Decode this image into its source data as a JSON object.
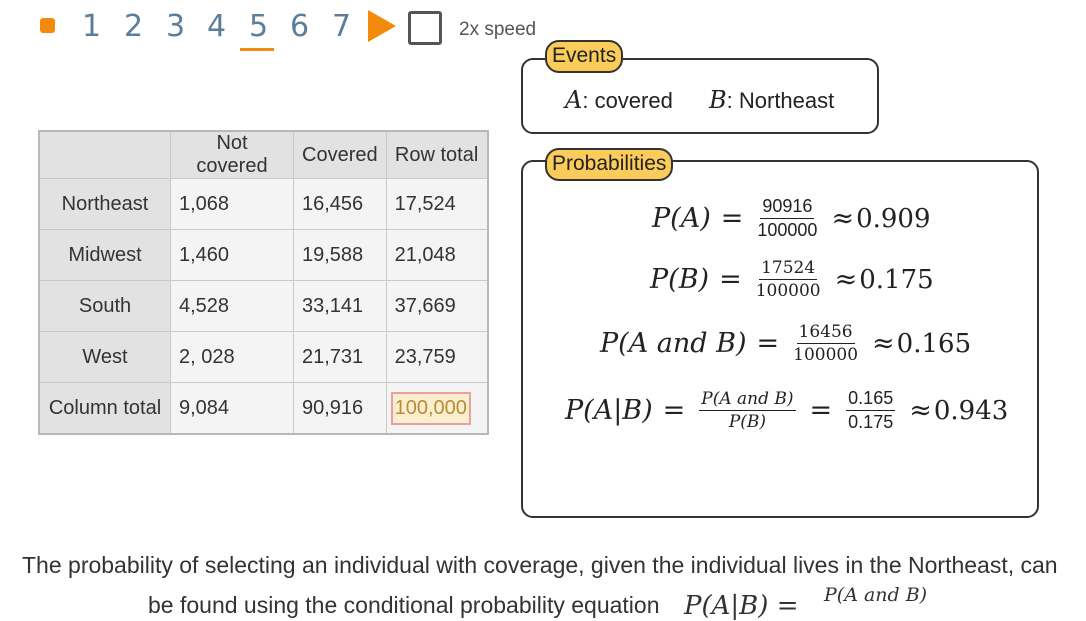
{
  "nav": {
    "steps": [
      "1",
      "2",
      "3",
      "4",
      "5",
      "6",
      "7"
    ],
    "active_step": "5",
    "speed_label": "2x speed"
  },
  "events": {
    "badge": "Events",
    "a_var": "A",
    "a_label": ": covered",
    "b_var": "B",
    "b_label": ": Northeast"
  },
  "table": {
    "headers": [
      "",
      "Not covered",
      "Covered",
      "Row total"
    ],
    "rows": [
      {
        "label": "Northeast",
        "cells": [
          "1,068",
          "16,456",
          "17,524"
        ]
      },
      {
        "label": "Midwest",
        "cells": [
          "1,460",
          "19,588",
          "21,048"
        ]
      },
      {
        "label": "South",
        "cells": [
          "4,528",
          "33,141",
          "37,669"
        ]
      },
      {
        "label": "West",
        "cells": [
          "2, 028",
          "21,731",
          "23,759"
        ]
      },
      {
        "label": "Column total",
        "cells": [
          "9,084",
          "90,916",
          "100,000"
        ]
      }
    ]
  },
  "probabilities": {
    "badge": "Probabilities",
    "pa": {
      "lhs": "P(A)",
      "num": "90916",
      "den": "100000",
      "approx": "0.909"
    },
    "pb": {
      "lhs": "P(B)",
      "num": "17524",
      "den": "100000",
      "approx": "0.175"
    },
    "pab": {
      "lhs": "P(A and B)",
      "num": "16456",
      "den": "100000",
      "approx": "0.165"
    },
    "pagb": {
      "lhs": "P(A|B)",
      "num1": "P(A and B)",
      "den1": "P(B)",
      "num2": "0.165",
      "den2": "0.175",
      "approx": "0.943"
    }
  },
  "paragraph": {
    "line1": "The probability of selecting an individual with coverage, given the individual lives in the Northeast, can",
    "line2": "be found using the conditional probability equation",
    "math": "P(A|B) =",
    "frac_num": "P(A and B)"
  }
}
